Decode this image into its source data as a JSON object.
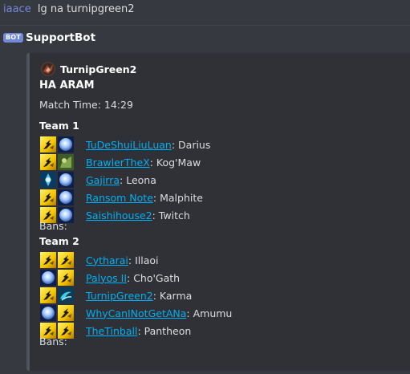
{
  "previous_message": {
    "author": "iaace",
    "content": "lg na turnipgreen2"
  },
  "bot_message": {
    "bot_tag": "BOT",
    "author": "SupportBot",
    "embed": {
      "author_name": "TurnipGreen2",
      "author_icon": "summoner-avatar-icon",
      "title": "HA ARAM",
      "match_time": "Match Time: 14:29",
      "teams": [
        {
          "name": "Team 1",
          "players": [
            {
              "summoner": "TuDeShuiLiuLuan",
              "champion": ": Darius",
              "spells": [
                "flash-spell-icon",
                "snowball-spell-icon"
              ]
            },
            {
              "summoner": "BrawlerTheX",
              "champion": ": Kog'Maw",
              "spells": [
                "flash-spell-icon",
                "exhaust-spell-icon"
              ]
            },
            {
              "summoner": "Gajirra",
              "champion": ": Leona",
              "spells": [
                "clarity-spell-icon",
                "snowball-spell-icon"
              ]
            },
            {
              "summoner": "Ransom Note",
              "champion": ": Malphite",
              "spells": [
                "flash-spell-icon",
                "snowball-spell-icon"
              ]
            },
            {
              "summoner": "Saishihouse2",
              "champion": ": Twitch",
              "spells": [
                "flash-spell-icon",
                "snowball-spell-icon"
              ]
            }
          ],
          "bans": "Bans:"
        },
        {
          "name": "Team 2",
          "players": [
            {
              "summoner": "Cytharai",
              "champion": ": Illaoi",
              "spells": [
                "flash-spell-icon",
                "flash-spell-icon"
              ]
            },
            {
              "summoner": "Palyos II",
              "champion": ": Cho'Gath",
              "spells": [
                "snowball-spell-icon",
                "flash-spell-icon"
              ]
            },
            {
              "summoner": "TurnipGreen2",
              "champion": ": Karma",
              "spells": [
                "flash-spell-icon",
                "ghost-spell-icon"
              ]
            },
            {
              "summoner": "WhyCanINotGetANa",
              "champion": ": Amumu",
              "spells": [
                "snowball-spell-icon",
                "flash-spell-icon"
              ]
            },
            {
              "summoner": "TheTinball",
              "champion": ": Pantheon",
              "spells": [
                "flash-spell-icon",
                "flash-spell-icon"
              ]
            }
          ],
          "bans": "Bans:"
        }
      ]
    }
  },
  "colors": {
    "background": "#36393f",
    "embed_background": "#2f3136",
    "embed_border": "#4f545c",
    "link": "#00b0f4",
    "username": "#7289da",
    "bot_tag": "#7289da"
  }
}
